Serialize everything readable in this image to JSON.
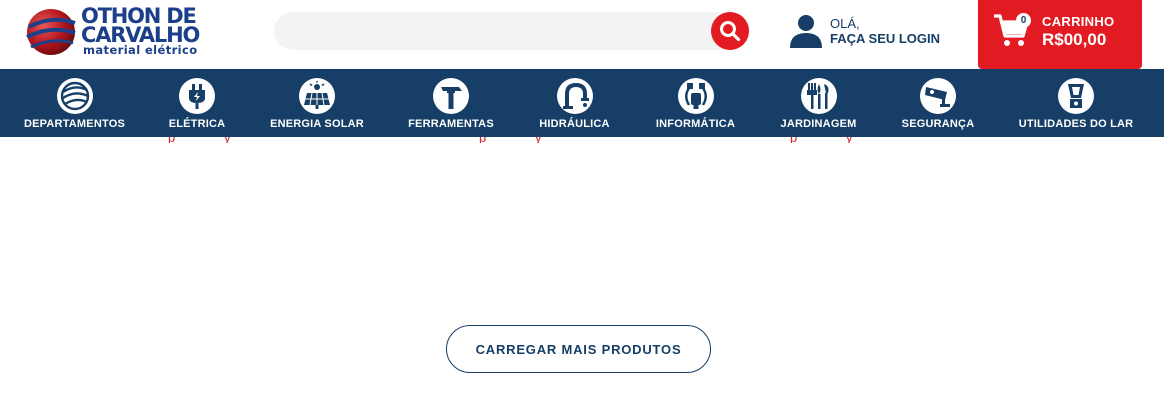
{
  "header": {
    "logo": {
      "line1": "OTHON DE",
      "line2": "CARVALHO",
      "subtitle": "material elétrico"
    },
    "search": {
      "placeholder": "",
      "button_icon": "search-icon"
    },
    "login": {
      "greeting": "OLÁ,",
      "action": "FAÇA SEU LOGIN",
      "icon": "user-icon"
    },
    "cart": {
      "title": "CARRINHO",
      "value": "R$00,00",
      "count": "0",
      "icon": "cart-icon"
    }
  },
  "nav": {
    "items": [
      {
        "label": "DEPARTAMENTOS",
        "icon": "globe-icon"
      },
      {
        "label": "ELÉTRICA",
        "icon": "plug-icon"
      },
      {
        "label": "ENERGIA SOLAR",
        "icon": "solar-panel-icon"
      },
      {
        "label": "FERRAMENTAS",
        "icon": "hammer-icon"
      },
      {
        "label": "HIDRÁULICA",
        "icon": "faucet-icon"
      },
      {
        "label": "INFORMÁTICA",
        "icon": "cables-icon"
      },
      {
        "label": "JARDINAGEM",
        "icon": "garden-tools-icon"
      },
      {
        "label": "SEGURANÇA",
        "icon": "security-camera-icon"
      },
      {
        "label": "UTILIDADES DO LAR",
        "icon": "blender-icon"
      }
    ]
  },
  "main": {
    "load_more_label": "CARREGAR MAIS PRODUTOS"
  },
  "colors": {
    "navy": "#163e66",
    "red": "#e21b23",
    "logo_blue": "#1c3f8a"
  }
}
